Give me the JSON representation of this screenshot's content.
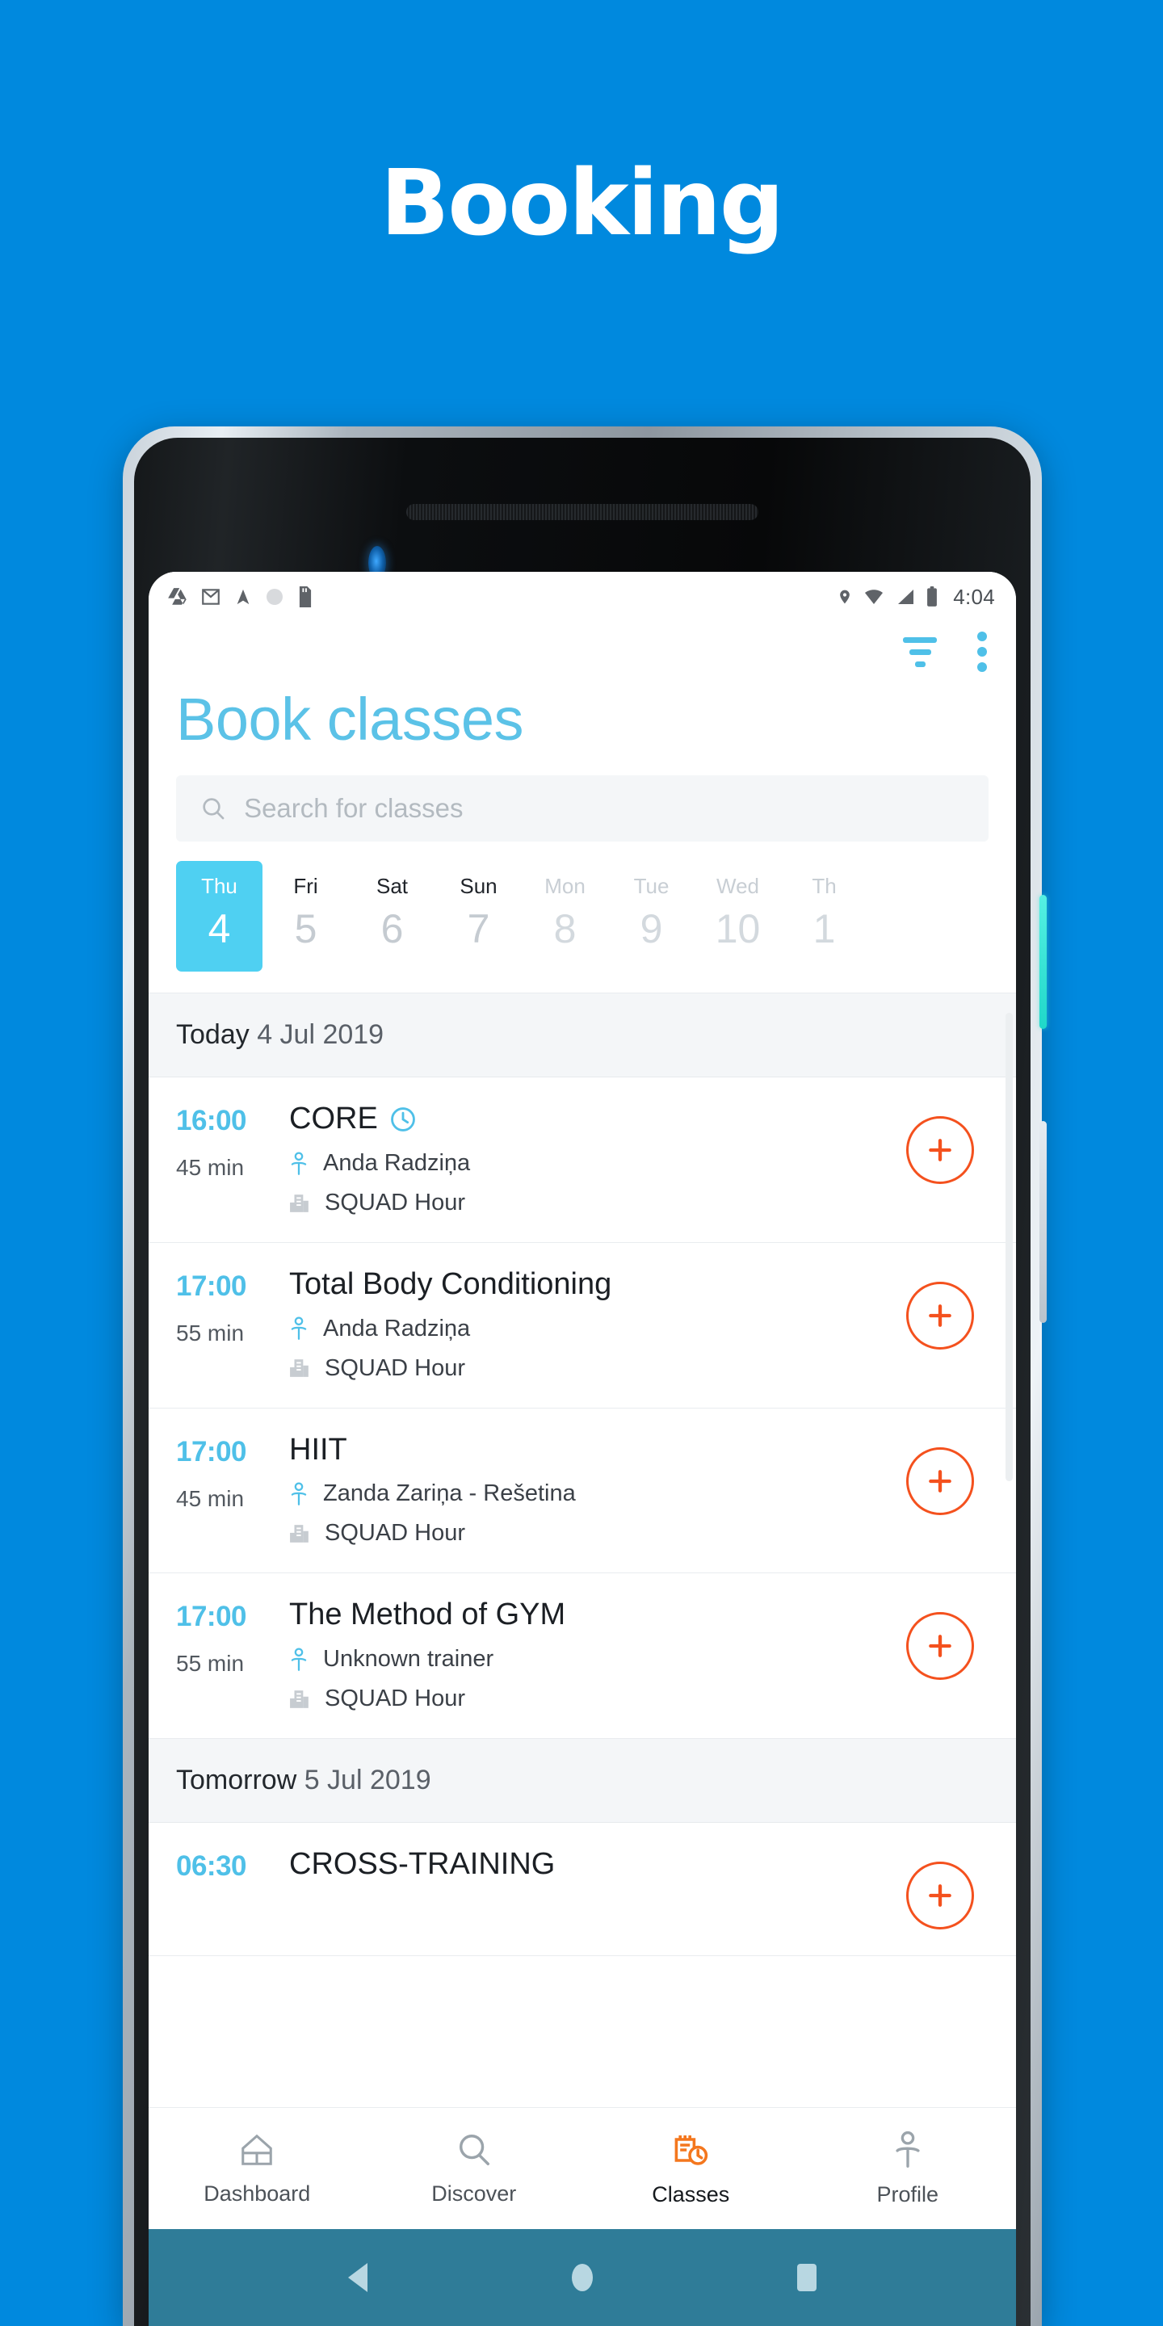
{
  "promo": {
    "title": "Booking"
  },
  "statusbar": {
    "time": "4:04",
    "left_icons": [
      "drive-icon",
      "gmail-icon",
      "navigation-icon",
      "circle-icon",
      "sdcard-icon"
    ],
    "right_icons": [
      "location-icon",
      "wifi-icon",
      "signal-icon",
      "battery-icon"
    ]
  },
  "topbar": {
    "filter_label": "filter-icon",
    "overflow_label": "more-options-icon"
  },
  "page": {
    "title": "Book classes"
  },
  "search": {
    "placeholder": "Search for classes",
    "value": "",
    "icon": "search-icon"
  },
  "date_strip": [
    {
      "dow": "Thu",
      "num": "4",
      "state": "active"
    },
    {
      "dow": "Fri",
      "num": "5",
      "state": "near"
    },
    {
      "dow": "Sat",
      "num": "6",
      "state": "near"
    },
    {
      "dow": "Sun",
      "num": "7",
      "state": "near"
    },
    {
      "dow": "Mon",
      "num": "8",
      "state": "far"
    },
    {
      "dow": "Tue",
      "num": "9",
      "state": "far"
    },
    {
      "dow": "Wed",
      "num": "10",
      "state": "far"
    },
    {
      "dow": "Th",
      "num": "1",
      "state": "far"
    }
  ],
  "sections": [
    {
      "label": "Today",
      "date": "4 Jul 2019",
      "classes": [
        {
          "time": "16:00",
          "duration": "45 min",
          "name": "CORE",
          "has_clock": true,
          "trainer": "Anda Radziņa",
          "venue": "SQUAD Hour",
          "add_label": "+"
        },
        {
          "time": "17:00",
          "duration": "55 min",
          "name": "Total Body Conditioning",
          "has_clock": false,
          "trainer": "Anda Radziņa",
          "venue": "SQUAD Hour",
          "add_label": "+"
        },
        {
          "time": "17:00",
          "duration": "45 min",
          "name": "HIIT",
          "has_clock": false,
          "trainer": "Zanda Zariņa - Rešetina",
          "venue": "SQUAD Hour",
          "add_label": "+"
        },
        {
          "time": "17:00",
          "duration": "55 min",
          "name": "The Method of GYM",
          "has_clock": false,
          "trainer": "Unknown trainer",
          "venue": "SQUAD Hour",
          "add_label": "+"
        }
      ]
    },
    {
      "label": "Tomorrow",
      "date": "5 Jul 2019",
      "classes": [
        {
          "time": "06:30",
          "duration": "",
          "name": "CROSS-TRAINING",
          "has_clock": false,
          "trainer": "",
          "venue": "",
          "add_label": "+"
        }
      ]
    }
  ],
  "bottom_nav": [
    {
      "label": "Dashboard",
      "icon": "home-icon",
      "active": false
    },
    {
      "label": "Discover",
      "icon": "search-icon",
      "active": false
    },
    {
      "label": "Classes",
      "icon": "calendar-clock-icon",
      "active": true
    },
    {
      "label": "Profile",
      "icon": "person-icon",
      "active": false
    }
  ],
  "system_nav": {
    "back": "back-triangle-icon",
    "home": "home-circle-icon",
    "recents": "recents-square-icon"
  },
  "colors": {
    "background": "#0089de",
    "accent_blue": "#4fc0e8",
    "selected_day": "#4fd0f2",
    "title_blue": "#5bc2e7",
    "add_orange": "#f4511e",
    "nav_active_orange": "#f4771e",
    "system_bar": "#2f7c98"
  }
}
